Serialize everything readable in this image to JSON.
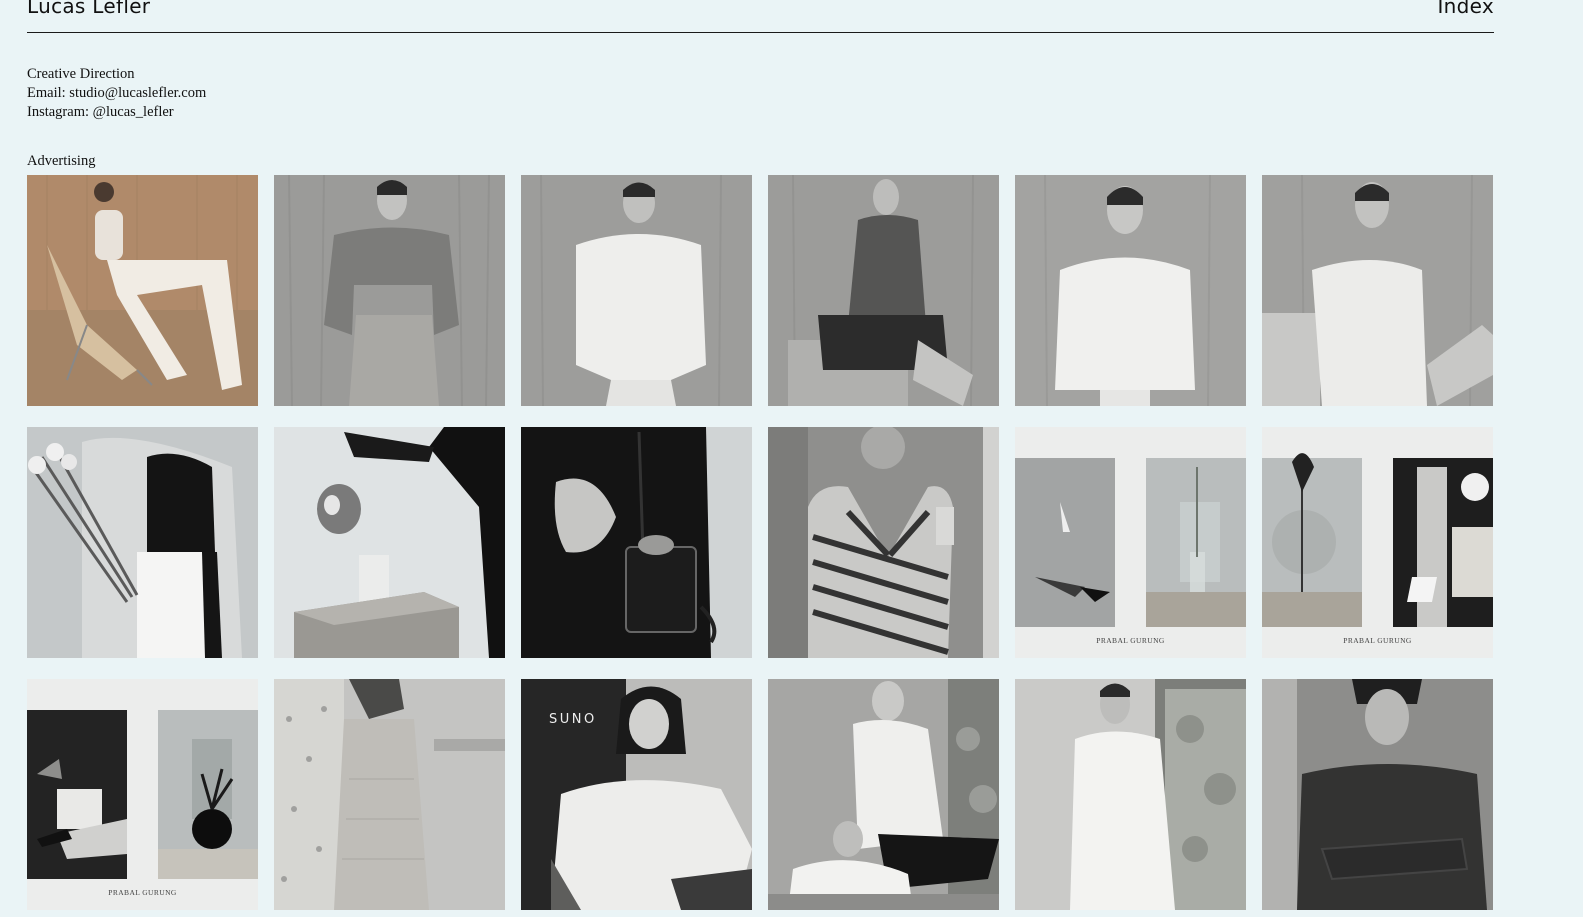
{
  "header": {
    "site_title": "Lucas Lefler",
    "index_label": "Index"
  },
  "info": {
    "role": "Creative Direction",
    "email_label": "Email:",
    "email": "studio@lucaslefler.com",
    "instagram_label": "Instagram:",
    "instagram": "@lucas_lefler"
  },
  "section": {
    "title": "Advertising"
  },
  "tiles": {
    "r2c5_caption": "PRABAL GURUNG",
    "r2c6_caption": "PRABAL GURUNG",
    "r3c1_caption": "PRABAL GURUNG",
    "r3c3_brand": "SUNO"
  },
  "colors": {
    "background": "#eaf4f6",
    "text": "#111111",
    "rule": "#1a1a1a"
  }
}
